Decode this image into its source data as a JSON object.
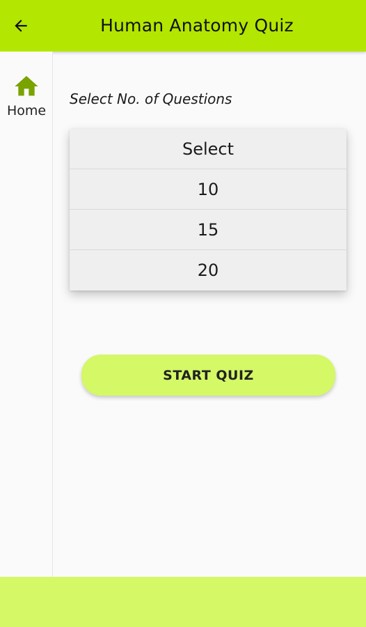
{
  "appbar": {
    "title": "Human Anatomy Quiz",
    "back_icon": "arrow-left-icon"
  },
  "rail": {
    "items": [
      {
        "label": "Home",
        "icon": "home-icon"
      }
    ]
  },
  "main": {
    "section_label": "Select No. of Questions",
    "options": [
      "Select",
      "10",
      "15",
      "20"
    ],
    "start_button_label": "START QUIZ"
  },
  "colors": {
    "appbar": "#b3e600",
    "accent_light": "#d4f866",
    "home_icon": "#7aa300"
  }
}
